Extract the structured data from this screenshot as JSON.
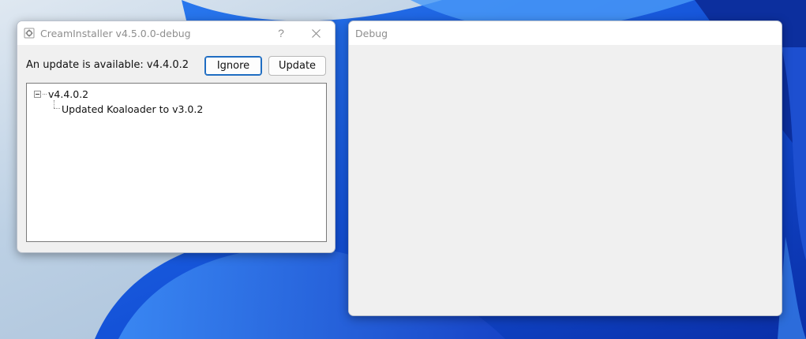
{
  "main_window": {
    "title": "CreamInstaller v4.5.0.0-debug",
    "help_label": "?",
    "update_message": "An update is available: v4.4.0.2",
    "ignore_label": "Ignore",
    "update_label": "Update",
    "changelog": {
      "version": "v4.4.0.2",
      "items": [
        "Updated Koaloader to v3.0.2"
      ]
    }
  },
  "debug_window": {
    "title": "Debug"
  },
  "icons": {
    "app": "gear-icon",
    "close": "close-icon",
    "tree_expander": "minus-box-icon"
  },
  "colors": {
    "accent_border": "#1f6dc2",
    "window_bg": "#f0f0f0",
    "wallpaper_blue": "#1e56d6"
  }
}
